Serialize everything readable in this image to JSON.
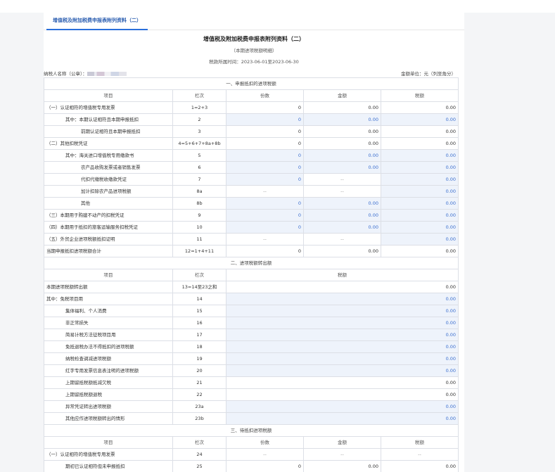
{
  "tab_label": "增值税及附加税费申报表附列资料（二）",
  "title": "增值税及附加税费申报表附列资料（二）",
  "subtitle": "（本期进项税额明细）",
  "period": "税款所属时间：2023-06-01至2023-06-30",
  "taxpayer_label": "纳税人名称（公章）：",
  "unit_label": "金额单位：元（列至角分）",
  "dash": "--",
  "section1": {
    "title": "一、申报抵扣的进项税额",
    "headers": [
      "项目",
      "栏次",
      "份数",
      "金额",
      "税额"
    ],
    "rows": [
      {
        "label": "（一）认证相符的增值税专用发票",
        "line": "1=2+3",
        "count": "0",
        "amount": "0.00",
        "tax": "0.00",
        "ind": 0,
        "ec": false,
        "ea": false,
        "et": false
      },
      {
        "label": "其中：本期认证相符且本期申报抵扣",
        "line": "2",
        "count": "0",
        "amount": "0.00",
        "tax": "0.00",
        "ind": 1,
        "ec": true,
        "ea": true,
        "et": true
      },
      {
        "label": "前期认证相符且本期申报抵扣",
        "line": "3",
        "count": "0",
        "amount": "0.00",
        "tax": "0.00",
        "ind": 2,
        "ec": false,
        "ea": false,
        "et": false
      },
      {
        "label": "（二）其他扣税凭证",
        "line": "4=5+6+7+8a+8b",
        "count": "0",
        "amount": "0.00",
        "tax": "0.00",
        "ind": 0,
        "ec": false,
        "ea": false,
        "et": false
      },
      {
        "label": "其中：海关进口增值税专用缴款书",
        "line": "5",
        "count": "0",
        "amount": "0.00",
        "tax": "0.00",
        "ind": 1,
        "ec": true,
        "ea": true,
        "et": true
      },
      {
        "label": "农产品收购发票或者销售发票",
        "line": "6",
        "count": "0",
        "amount": "0.00",
        "tax": "0.00",
        "ind": 2,
        "ec": true,
        "ea": true,
        "et": true
      },
      {
        "label": "代扣代缴税收缴款凭证",
        "line": "7",
        "count": "0",
        "amount": "--",
        "tax": "0.00",
        "ind": 2,
        "ec": true,
        "ea": false,
        "et": true
      },
      {
        "label": "加计扣除农产品进项税额",
        "line": "8a",
        "count": "--",
        "amount": "--",
        "tax": "0.00",
        "ind": 2,
        "ec": false,
        "ea": false,
        "et": true
      },
      {
        "label": "其他",
        "line": "8b",
        "count": "0",
        "amount": "0.00",
        "tax": "0.00",
        "ind": 2,
        "ec": true,
        "ea": true,
        "et": true
      },
      {
        "label": "（三）本期用于购建不动产的扣税凭证",
        "line": "9",
        "count": "0",
        "amount": "0.00",
        "tax": "0.00",
        "ind": 0,
        "ec": true,
        "ea": true,
        "et": true
      },
      {
        "label": "（四）本期用于抵扣的旅客运输服务扣税凭证",
        "line": "10",
        "count": "0",
        "amount": "0.00",
        "tax": "0.00",
        "ind": 0,
        "ec": true,
        "ea": true,
        "et": true
      },
      {
        "label": "（五）外贸企业进项税额抵扣证明",
        "line": "11",
        "count": "--",
        "amount": "--",
        "tax": "0.00",
        "ind": 0,
        "ec": false,
        "ea": false,
        "et": true
      },
      {
        "label": "当期申报抵扣进项税额合计",
        "line": "12=1+4+11",
        "count": "0",
        "amount": "0.00",
        "tax": "0.00",
        "ind": -1,
        "ec": false,
        "ea": false,
        "et": false
      }
    ]
  },
  "section2": {
    "title": "二、进项税额转出额",
    "headers": [
      "项目",
      "栏次",
      "税额"
    ],
    "rows": [
      {
        "label": "本期进项税额转出额",
        "line": "13=14至23之和",
        "tax": "0.00",
        "ind": -1,
        "et": false
      },
      {
        "label": "其中：免税项目用",
        "line": "14",
        "tax": "0.00",
        "ind": -1,
        "et": true
      },
      {
        "label": "集体福利、个人消费",
        "line": "15",
        "tax": "0.00",
        "ind": 1,
        "et": true
      },
      {
        "label": "非正常损失",
        "line": "16",
        "tax": "0.00",
        "ind": 1,
        "et": true
      },
      {
        "label": "简易计税方法征税项目用",
        "line": "17",
        "tax": "0.00",
        "ind": 1,
        "et": true
      },
      {
        "label": "免抵退税办法不得抵扣的进项税额",
        "line": "18",
        "tax": "0.00",
        "ind": 1,
        "et": true
      },
      {
        "label": "纳税检查调减进项税额",
        "line": "19",
        "tax": "0.00",
        "ind": 1,
        "et": true
      },
      {
        "label": "红字专用发票信息表注明的进项税额",
        "line": "20",
        "tax": "0.00",
        "ind": 1,
        "et": true
      },
      {
        "label": "上期留抵税额抵减欠税",
        "line": "21",
        "tax": "0.00",
        "ind": 1,
        "et": false
      },
      {
        "label": "上期留抵税额退税",
        "line": "22",
        "tax": "0.00",
        "ind": 1,
        "et": false
      },
      {
        "label": "异常凭证转出进项税额",
        "line": "23a",
        "tax": "0.00",
        "ind": 1,
        "et": true
      },
      {
        "label": "其他应作进项税额转出的情形",
        "line": "23b",
        "tax": "0.00",
        "ind": 1,
        "et": true
      }
    ]
  },
  "section3": {
    "title": "三、待抵扣进项税额",
    "headers": [
      "项目",
      "栏次",
      "份数",
      "金额",
      "税额"
    ],
    "rows": [
      {
        "label": "（一）认证相符的增值税专用发票",
        "line": "24",
        "count": "--",
        "amount": "--",
        "tax": "--",
        "ind": 0,
        "ec": false,
        "ea": false,
        "et": false
      },
      {
        "label": "期初已认证相符但未申报抵扣",
        "line": "25",
        "count": "0",
        "amount": "0.00",
        "tax": "0.00",
        "ind": 1,
        "ec": false,
        "ea": false,
        "et": false
      }
    ]
  }
}
